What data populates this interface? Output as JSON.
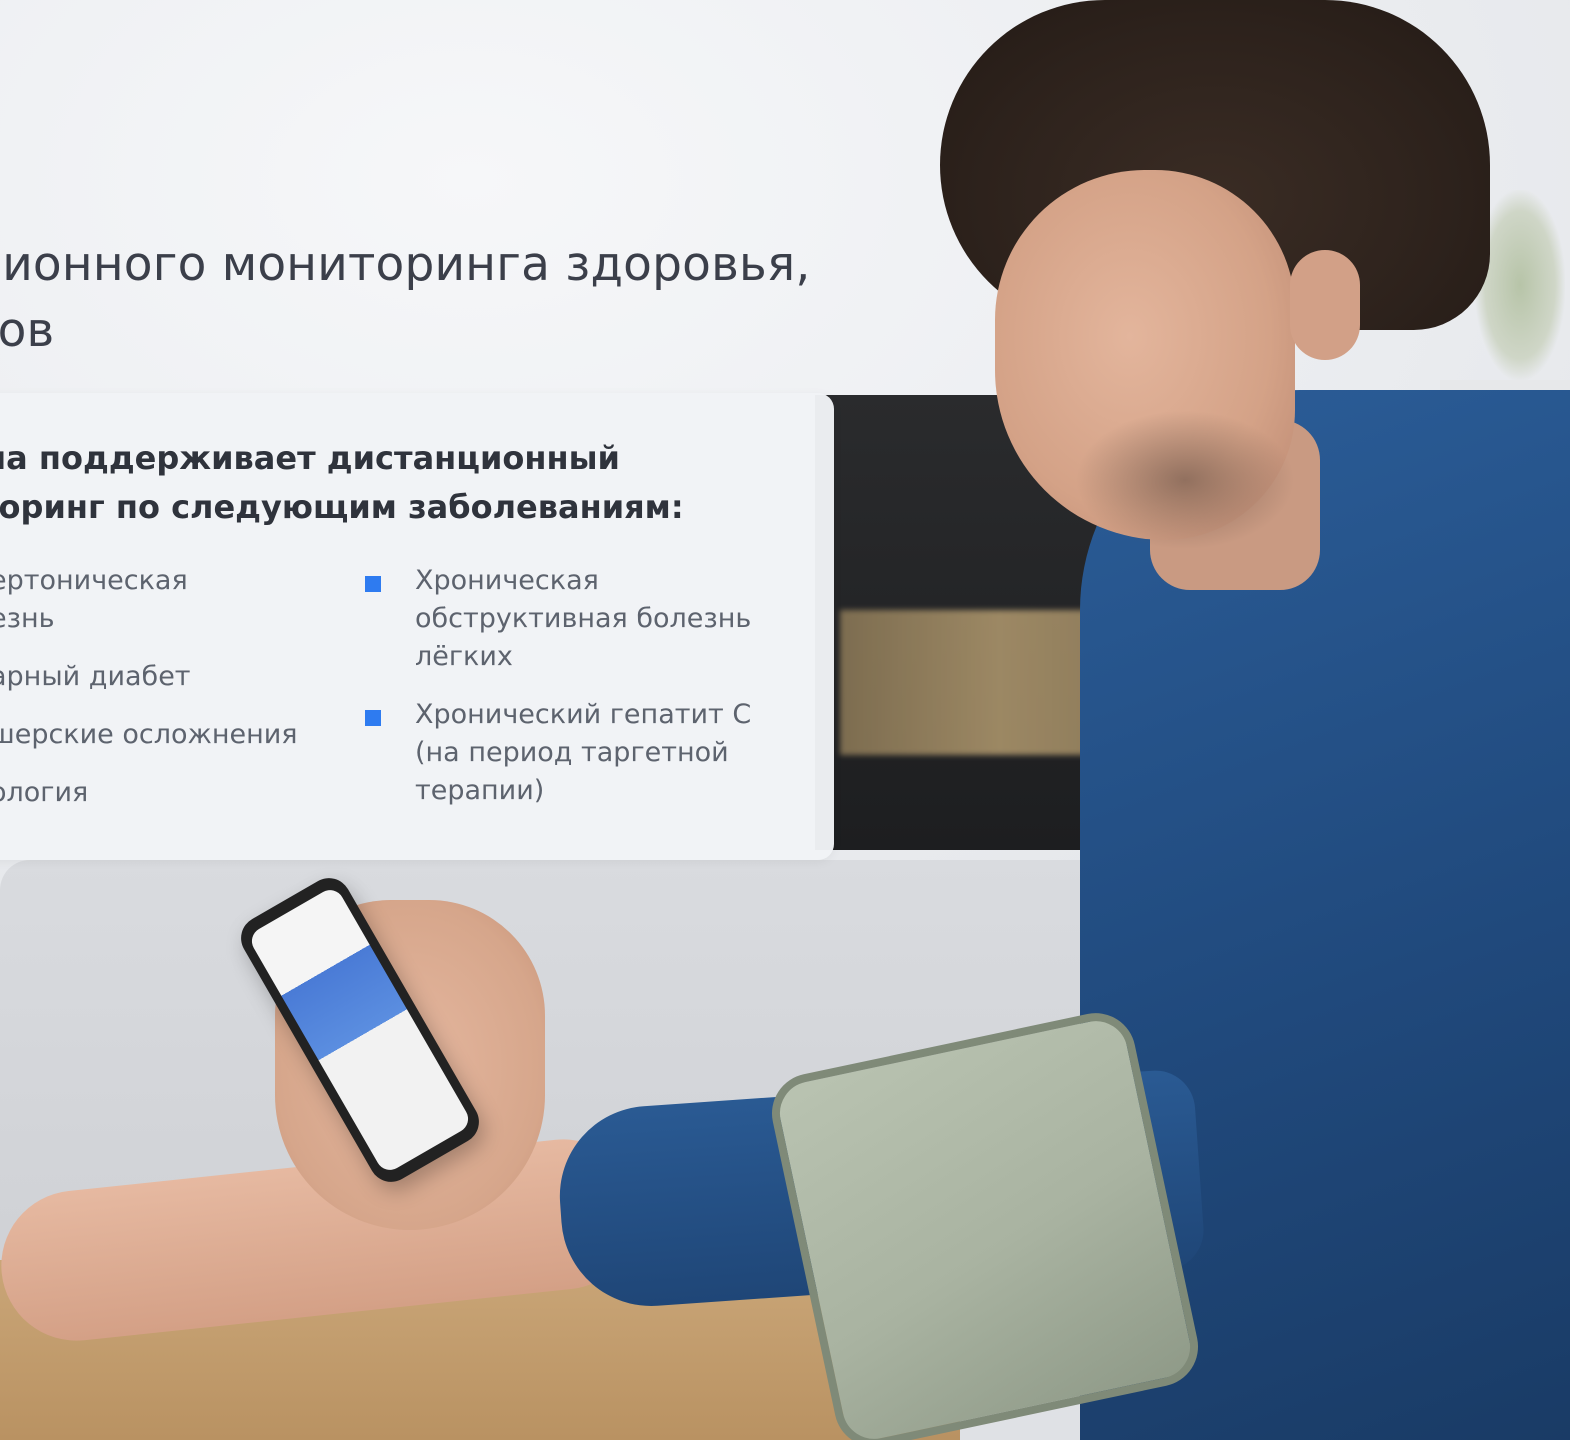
{
  "headline": {
    "line1": "ционного мониторинга здоровья,",
    "line2": "тов"
  },
  "card": {
    "title_line1": "ма поддерживает дистанционный",
    "title_line2": "торинг по следующим заболеваниям:",
    "left_items": [
      {
        "line1": "ертоническая",
        "line2": "езнь"
      },
      {
        "line1": "арный диабет"
      },
      {
        "line1": "шерские осложнения"
      },
      {
        "line1": "ология"
      }
    ],
    "right_items": [
      {
        "line1": "Хроническая",
        "line2": "обструктивная болезнь",
        "line3": "лёгких"
      },
      {
        "line1": "Хронический гепатит С",
        "line2": "(на период таргетной",
        "line3": "терапии)"
      }
    ],
    "bullet_color": "#2e7bf0"
  },
  "icons": {
    "bullet": "square-bullet-icon"
  }
}
